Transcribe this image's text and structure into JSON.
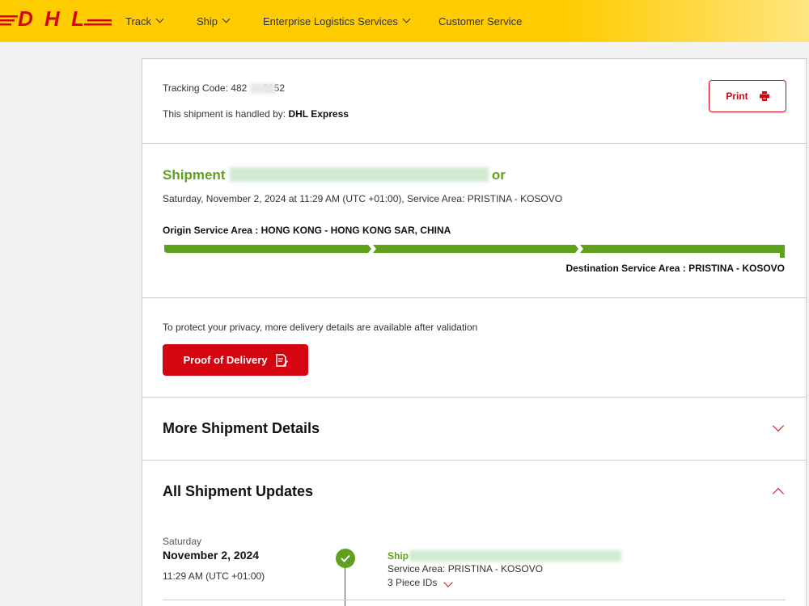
{
  "header": {
    "logo_text": "DHL",
    "nav": [
      {
        "label": "Track",
        "has_dropdown": true
      },
      {
        "label": "Ship",
        "has_dropdown": true
      },
      {
        "label": "Enterprise Logistics Services",
        "has_dropdown": true
      },
      {
        "label": "Customer Service",
        "has_dropdown": false
      }
    ]
  },
  "summary": {
    "tracking_label": "Tracking Code:",
    "tracking_value": "482      9152",
    "handled_label": "This shipment is handled by:",
    "handled_value": "DHL Express",
    "print_label": "Print",
    "print_icon": "printer-icon"
  },
  "status": {
    "title_visible": "Shipment",
    "title_tail": "or",
    "timestamp": "Saturday, November 2, 2024 at 11:29 AM (UTC +01:00), Service Area: PRISTINA - KOSOVO",
    "origin_label": "Origin Service Area :",
    "origin_value": "HONG KONG - HONG KONG SAR, CHINA",
    "destination_label": "Destination Service Area :",
    "destination_value": "PRISTINA - KOSOVO",
    "progress": 1.0,
    "accent_color": "#5fa01d"
  },
  "privacy": {
    "note": "To protect your privacy, more delivery details are available after validation",
    "pod_label": "Proof of Delivery",
    "pod_icon": "document-edit-icon"
  },
  "more_details": {
    "title": "More Shipment Details",
    "expanded": false
  },
  "updates": {
    "title": "All Shipment Updates",
    "expanded": true,
    "items": [
      {
        "weekday": "Saturday",
        "date": "November 2, 2024",
        "time": "11:29 AM (UTC +01:00)",
        "event_visible": "Ship",
        "service_area": "Service Area: PRISTINA - KOSOVO",
        "piece_ids": "3 Piece IDs"
      }
    ]
  },
  "colors": {
    "brand_yellow": "#ffcc00",
    "brand_red": "#d40511",
    "success_green": "#5fa01d"
  }
}
